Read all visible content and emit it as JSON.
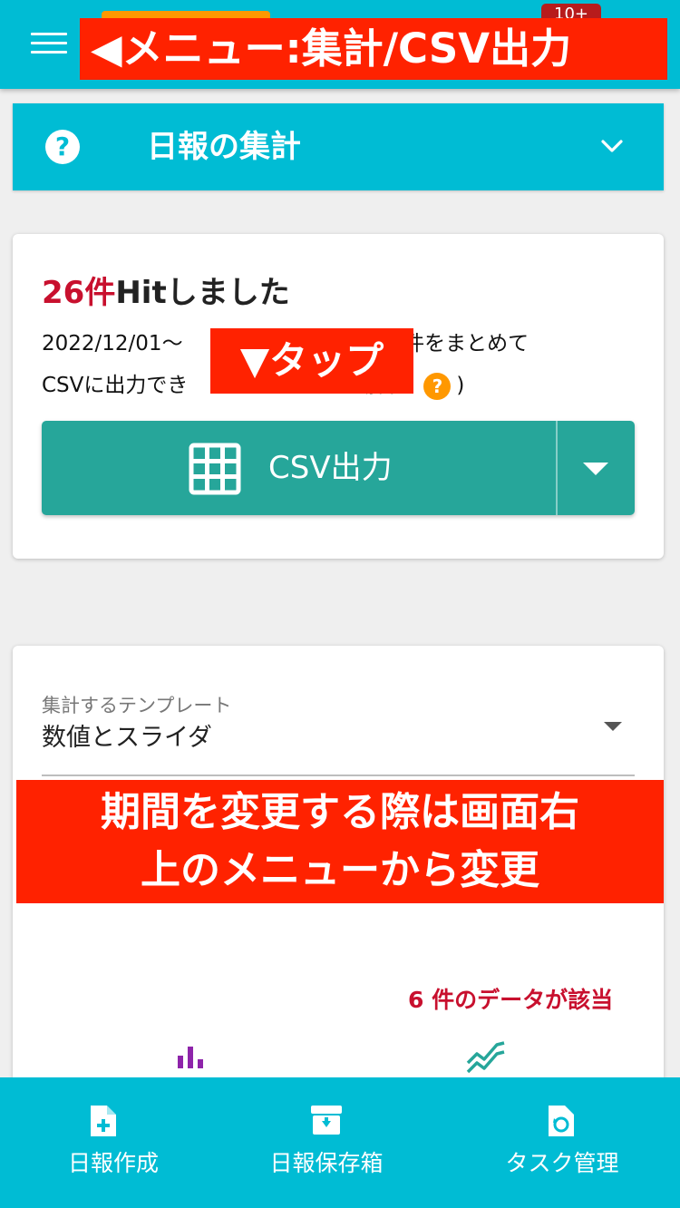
{
  "header": {
    "menu_icon": "hamburger-menu-icon",
    "notification_badge": "10+",
    "annotation": "◀メニュー:集計/CSV出力"
  },
  "panel": {
    "help_icon": "question-circle-icon",
    "help_glyph": "?",
    "title": "日報の集計",
    "chevron_icon": "chevron-down-icon"
  },
  "summary": {
    "hit_count": "26件",
    "hit_suffix": "Hitしました",
    "desc_line1": "2022/12/01〜 　　　　　　　ータ26件をまとめて",
    "desc_line2": "CSVに出力でき　　　　　　する場合",
    "desc_help_glyph": "?",
    "desc_close_paren": ")",
    "annotation_tap": "▼タップ",
    "csv_button_label": "CSV出力",
    "csv_icon": "table-grid-icon",
    "dropdown_icon": "caret-down-icon"
  },
  "template_select": {
    "label": "集計するテンプレート",
    "value": "数値とスライダ",
    "annotation_line1": "期間を変更する際は画面右",
    "annotation_line2": "上のメニューから変更",
    "data_count": "6 件のデータが該当",
    "bar_chart_icon": "bar-chart-icon",
    "line_chart_icon": "line-chart-icon"
  },
  "bottom_nav": {
    "items": [
      {
        "label": "日報作成",
        "icon": "file-plus-icon"
      },
      {
        "label": "日報保存箱",
        "icon": "archive-box-icon"
      },
      {
        "label": "タスク管理",
        "icon": "file-refresh-icon"
      }
    ]
  },
  "colors": {
    "primary": "#00bcd4",
    "csv_button": "#26a69a",
    "annotation": "#ff2200",
    "hit_red": "#c8102e",
    "badge": "#b71c1c",
    "help_orange": "#ff9800",
    "bar_chart": "#8e24aa",
    "line_chart": "#26a69a"
  }
}
